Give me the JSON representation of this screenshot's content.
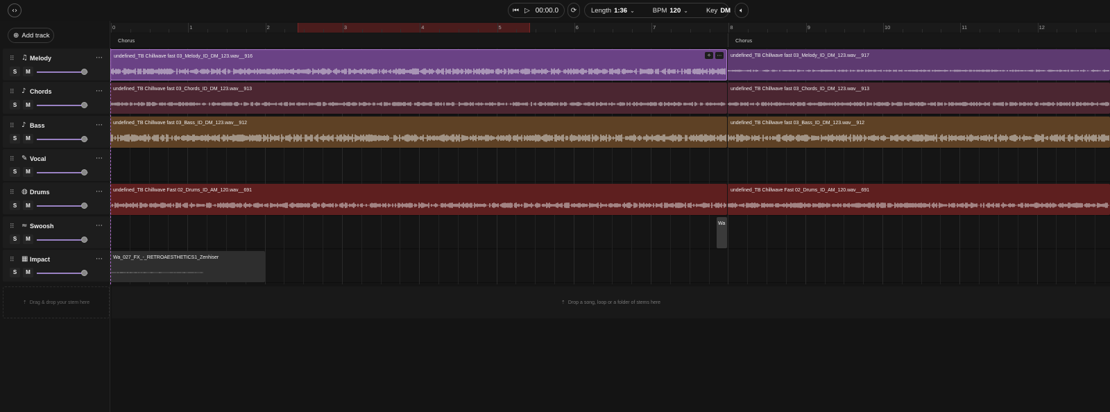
{
  "topbar": {
    "corner_icon": "code-brackets-icon",
    "time": "00:00.0",
    "length_label": "Length",
    "length_value": "1:36",
    "bpm_label": "BPM",
    "bpm_value": "120",
    "key_label": "Key",
    "key_value": "DM"
  },
  "left": {
    "add_track_label": "Add track",
    "drop_stem_label": "Drag & drop your stem here"
  },
  "tracks": [
    {
      "name": "Melody",
      "icon": "music-note-icon",
      "volume": 0.92
    },
    {
      "name": "Chords",
      "icon": "guitar-icon",
      "volume": 0.92
    },
    {
      "name": "Bass",
      "icon": "bass-guitar-icon",
      "volume": 0.92
    },
    {
      "name": "Vocal",
      "icon": "microphone-icon",
      "volume": 0.92
    },
    {
      "name": "Drums",
      "icon": "drum-icon",
      "volume": 0.92
    },
    {
      "name": "Swoosh",
      "icon": "swoosh-icon",
      "volume": 0.92
    },
    {
      "name": "Impact",
      "icon": "impact-icon",
      "volume": 0.92
    }
  ],
  "solo_label": "S",
  "mute_label": "M",
  "ruler": {
    "numbers": [
      "0",
      "1",
      "2",
      "3",
      "4",
      "5",
      "6",
      "7",
      "8",
      "9",
      "10",
      "11",
      "12"
    ]
  },
  "sections": [
    {
      "name": "Chorus"
    },
    {
      "name": "Chorus"
    }
  ],
  "clips": {
    "melody_1": "undefined_TB Chillwave fast 03_Melody_ID_DM_123.wav__916",
    "melody_2": "undefined_TB Chillwave fast 03_Melody_ID_DM_123.wav__917",
    "chords_1": "undefined_TB Chillwave fast 03_Chords_ID_DM_123.wav__913",
    "chords_2": "undefined_TB Chillwave fast 03_Chords_ID_DM_123.wav__913",
    "bass_1": "undefined_TB Chillwave fast 03_Bass_ID_DM_123.wav__912",
    "bass_2": "undefined_TB Chillwave fast 03_Bass_ID_DM_123.wav__912",
    "drums_1": "undefined_TB Chillwave Fast 02_Drums_ID_AM_120.wav__691",
    "drums_2": "undefined_TB Chillwave Fast 02_Drums_ID_AM_120.wav__691",
    "swoosh_1": "Wa",
    "impact_1": "Wa_027_FX_-_RETROAESTHETICS1_Zenhiser"
  },
  "drop_song_label": "Drop a song, loop or a folder of stems here"
}
